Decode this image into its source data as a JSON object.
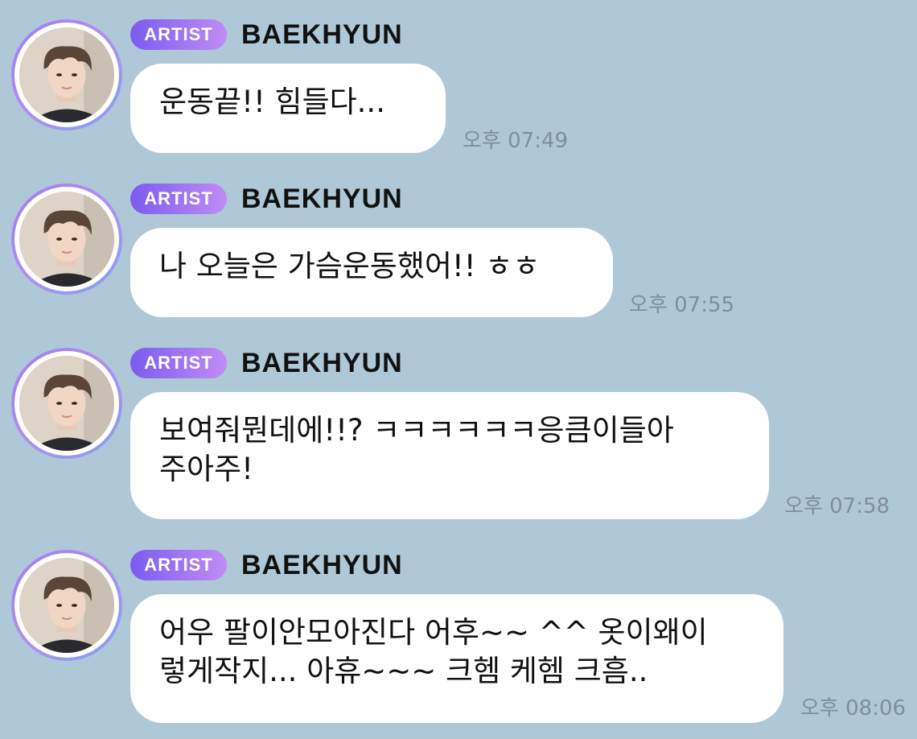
{
  "chat": {
    "messages": [
      {
        "badge": "ARTIST",
        "sender": "BAEKHYUN",
        "text": "운동끝!! 힘들다...",
        "time": "오후 07:49"
      },
      {
        "badge": "ARTIST",
        "sender": "BAEKHYUN",
        "text": "나 오늘은 가슴운동했어!! ㅎㅎ",
        "time": "오후 07:55"
      },
      {
        "badge": "ARTIST",
        "sender": "BAEKHYUN",
        "text": "보여줘뭔데에!!? ㅋㅋㅋㅋㅋㅋ응큼이들아\n주아주!",
        "time": "오후 07:58"
      },
      {
        "badge": "ARTIST",
        "sender": "BAEKHYUN",
        "text": "어우 팔이안모아진다 어후~~ ^^ 옷이왜이\n렇게작지... 아휴~~~ 크헴 케헴 크흠..",
        "time": "오후 08:06"
      }
    ]
  },
  "colors": {
    "background": "#afc8d7",
    "bubble": "#ffffff",
    "badge_start": "#7b5cf0",
    "badge_end": "#c08cf3",
    "timestamp": "#7f8f9a"
  },
  "icons": {
    "avatar": "profile-photo"
  }
}
